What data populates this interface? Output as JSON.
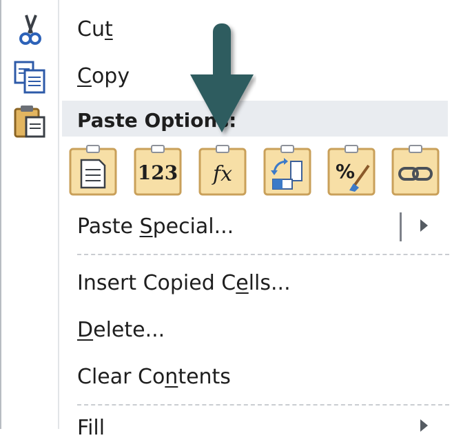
{
  "menu": {
    "items": {
      "cut": {
        "pre": "Cu",
        "acc": "t",
        "post": ""
      },
      "copy": {
        "pre": "",
        "acc": "C",
        "post": "opy"
      },
      "paste_special": {
        "pre": "Paste ",
        "acc": "S",
        "post": "pecial..."
      },
      "insert_copied": {
        "pre": "Insert Copied C",
        "acc": "e",
        "post": "lls..."
      },
      "delete": {
        "pre": "",
        "acc": "D",
        "post": "elete..."
      },
      "clear_contents": {
        "pre": "Clear Co",
        "acc": "n",
        "post": "tents"
      },
      "fill": {
        "pre": "Fill",
        "acc": "",
        "post": ""
      }
    },
    "paste_options_header": "Paste Options:",
    "paste_buttons": [
      {
        "name": "paste",
        "icon": "paste-document-icon"
      },
      {
        "name": "values",
        "icon": "paste-values-icon",
        "label": "123"
      },
      {
        "name": "formulas",
        "icon": "paste-formulas-icon",
        "label": "fx"
      },
      {
        "name": "transpose",
        "icon": "paste-transpose-icon"
      },
      {
        "name": "formatting",
        "icon": "paste-formatting-icon",
        "label": "%"
      },
      {
        "name": "link",
        "icon": "paste-link-icon"
      }
    ],
    "colors": {
      "header_bg": "#e9ecf0",
      "clipboard_fill": "#f7dfa6",
      "clipboard_border": "#c9a05a",
      "arrow": "#2f5b5f"
    }
  }
}
